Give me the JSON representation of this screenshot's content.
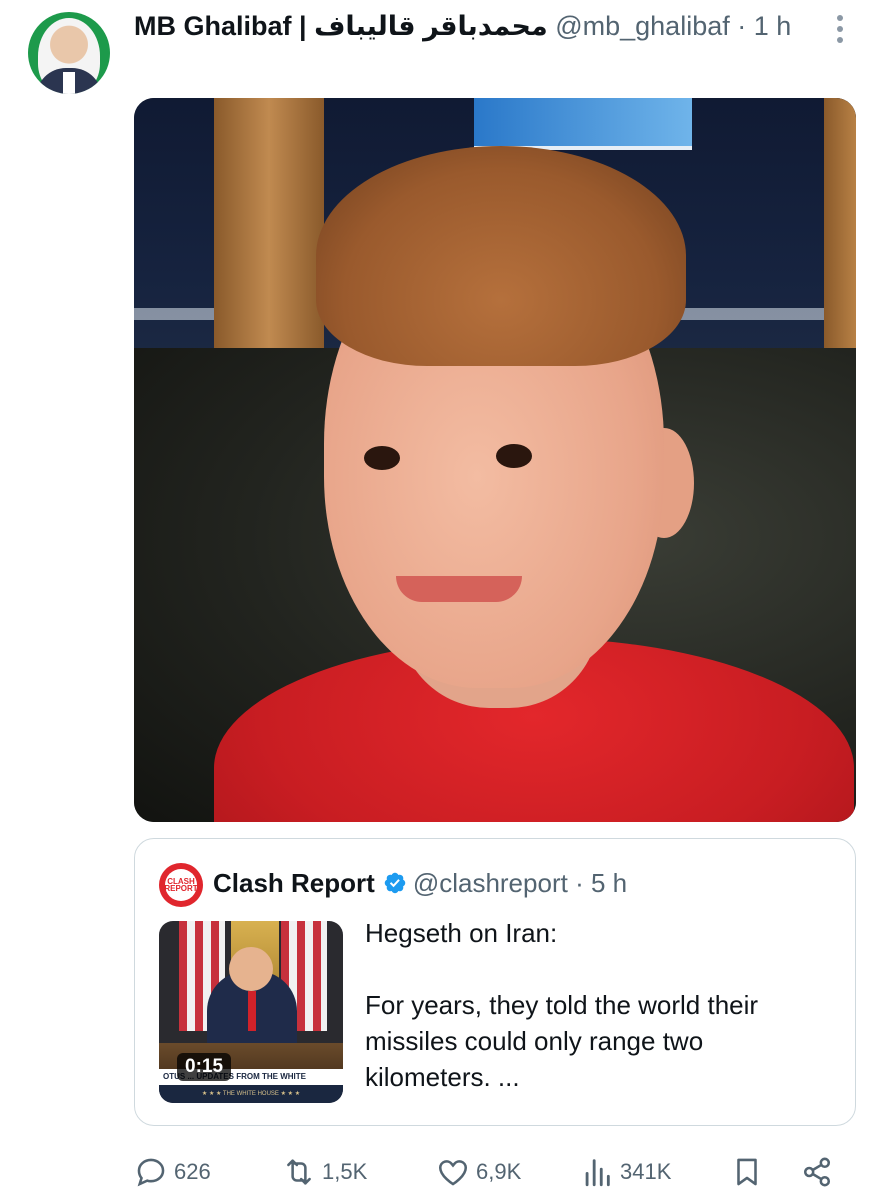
{
  "post": {
    "author_name": "MB Ghalibaf | محمدباقر قالیباف",
    "handle": "@mb_ghalibaf",
    "separator": "·",
    "time": "1 h"
  },
  "quote": {
    "author_name": "Clash Report",
    "handle": "@clashreport",
    "separator": "·",
    "time": "5 h",
    "logo_text": "CLASH REPORT",
    "thumbnail": {
      "duration": "0:15",
      "ticker": "OTUS  ...  UPDATES FROM THE WHITE",
      "subticker": "★ ★ ★  THE WHITE HOUSE  ★ ★ ★"
    },
    "text_line1": "Hegseth on Iran:",
    "text_line2": "For years, they told the world their missiles could only range two kilometers. ..."
  },
  "actions": {
    "replies": "626",
    "reposts": "1,5K",
    "likes": "6,9K",
    "views": "341K"
  },
  "colors": {
    "secondary_text": "#536471",
    "verified": "#1d9bf0",
    "border": "#cfd9de"
  }
}
